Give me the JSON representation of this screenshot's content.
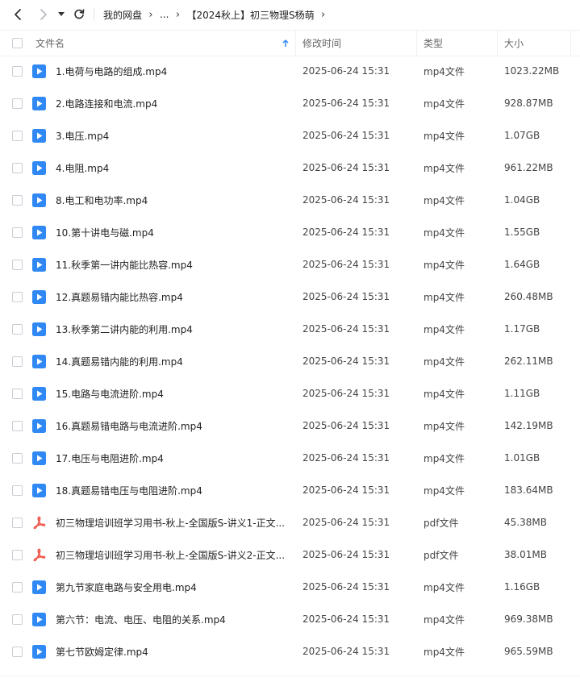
{
  "nav": {
    "crumbs": [
      "我的网盘",
      "...",
      "【2024秋上】初三物理S杨萌"
    ]
  },
  "header": {
    "name": "文件名",
    "modified": "修改时间",
    "type": "类型",
    "size": "大小"
  },
  "colors": {
    "accent": "#2f88f4",
    "pdf": "#f05a4f"
  },
  "files": [
    {
      "name": "1.电荷与电路的组成.mp4",
      "time": "2025-06-24 15:31",
      "type": "mp4文件",
      "size": "1023.22MB",
      "icon": "video-file-icon"
    },
    {
      "name": "2.电路连接和电流.mp4",
      "time": "2025-06-24 15:31",
      "type": "mp4文件",
      "size": "928.87MB",
      "icon": "video-file-icon"
    },
    {
      "name": "3.电压.mp4",
      "time": "2025-06-24 15:31",
      "type": "mp4文件",
      "size": "1.07GB",
      "icon": "video-file-icon"
    },
    {
      "name": "4.电阻.mp4",
      "time": "2025-06-24 15:31",
      "type": "mp4文件",
      "size": "961.22MB",
      "icon": "video-file-icon"
    },
    {
      "name": "8.电工和电功率.mp4",
      "time": "2025-06-24 15:31",
      "type": "mp4文件",
      "size": "1.04GB",
      "icon": "video-file-icon"
    },
    {
      "name": "10.第十讲电与磁.mp4",
      "time": "2025-06-24 15:31",
      "type": "mp4文件",
      "size": "1.55GB",
      "icon": "video-file-icon"
    },
    {
      "name": "11.秋季第一讲内能比热容.mp4",
      "time": "2025-06-24 15:31",
      "type": "mp4文件",
      "size": "1.64GB",
      "icon": "video-file-icon"
    },
    {
      "name": "12.真题易错内能比热容.mp4",
      "time": "2025-06-24 15:31",
      "type": "mp4文件",
      "size": "260.48MB",
      "icon": "video-file-icon"
    },
    {
      "name": "13.秋季第二讲内能的利用.mp4",
      "time": "2025-06-24 15:31",
      "type": "mp4文件",
      "size": "1.17GB",
      "icon": "video-file-icon"
    },
    {
      "name": "14.真题易错内能的利用.mp4",
      "time": "2025-06-24 15:31",
      "type": "mp4文件",
      "size": "262.11MB",
      "icon": "video-file-icon"
    },
    {
      "name": "15.电路与电流进阶.mp4",
      "time": "2025-06-24 15:31",
      "type": "mp4文件",
      "size": "1.11GB",
      "icon": "video-file-icon"
    },
    {
      "name": "16.真题易错电路与电流进阶.mp4",
      "time": "2025-06-24 15:31",
      "type": "mp4文件",
      "size": "142.19MB",
      "icon": "video-file-icon"
    },
    {
      "name": "17.电压与电阻进阶.mp4",
      "time": "2025-06-24 15:31",
      "type": "mp4文件",
      "size": "1.01GB",
      "icon": "video-file-icon"
    },
    {
      "name": "18.真题易错电压与电阻进阶.mp4",
      "time": "2025-06-24 15:31",
      "type": "mp4文件",
      "size": "183.64MB",
      "icon": "video-file-icon"
    },
    {
      "name": "初三物理培训班学习用书-秋上-全国版S-讲义1-正文...",
      "time": "2025-06-24 15:31",
      "type": "pdf文件",
      "size": "45.38MB",
      "icon": "pdf-file-icon"
    },
    {
      "name": "初三物理培训班学习用书-秋上-全国版S-讲义2-正文...",
      "time": "2025-06-24 15:31",
      "type": "pdf文件",
      "size": "38.01MB",
      "icon": "pdf-file-icon"
    },
    {
      "name": "第九节家庭电路与安全用电.mp4",
      "time": "2025-06-24 15:31",
      "type": "mp4文件",
      "size": "1.16GB",
      "icon": "video-file-icon"
    },
    {
      "name": "第六节：电流、电压、电阻的关系.mp4",
      "time": "2025-06-24 15:31",
      "type": "mp4文件",
      "size": "969.38MB",
      "icon": "video-file-icon"
    },
    {
      "name": "第七节欧姆定律.mp4",
      "time": "2025-06-24 15:31",
      "type": "mp4文件",
      "size": "965.59MB",
      "icon": "video-file-icon"
    }
  ]
}
